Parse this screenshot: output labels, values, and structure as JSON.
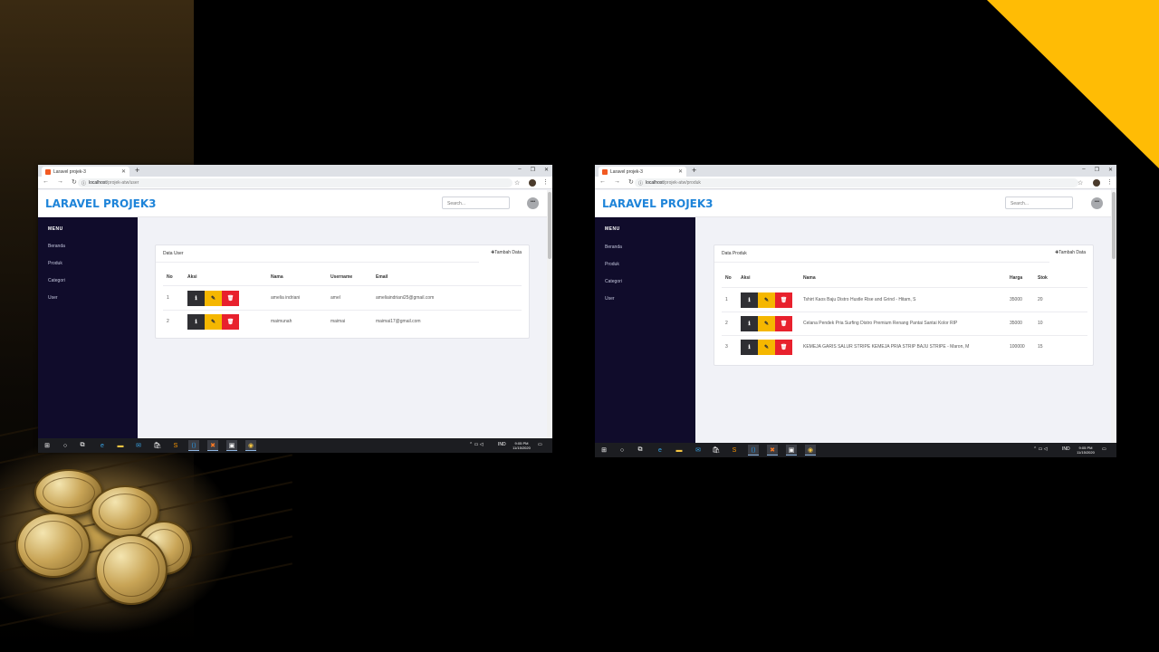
{
  "left_window": {
    "tab_title": "Laravel projek-3",
    "url_host": "localhost",
    "url_path": "/projek-atw/user",
    "app_title": "LARAVEL PROJEK3",
    "search_placeholder": "Search...",
    "avatar_text": "•••",
    "sidebar_menu_title": "MENU",
    "sidebar_items": [
      "Beranda",
      "Produk",
      "Categori",
      "User"
    ],
    "card_title": "Data User",
    "add_button": "✚Tambah Data",
    "table_headers": [
      "No",
      "Aksi",
      "Nama",
      "Username",
      "Email"
    ],
    "rows": [
      {
        "no": "1",
        "nama": "amelia indriani",
        "username": "amel",
        "email": "ameliaindriani25@gmail.com"
      },
      {
        "no": "2",
        "nama": "maimunah",
        "username": "maimai",
        "email": "maimai17@gmail.com"
      }
    ],
    "taskbar_lang": "IND",
    "taskbar_time": "9:05 PM",
    "taskbar_date": "11/15/2020"
  },
  "right_window": {
    "tab_title": "Laravel projek-3",
    "url_host": "localhost",
    "url_path": "/projek-atw/produk",
    "app_title": "LARAVEL PROJEK3",
    "search_placeholder": "Search...",
    "avatar_text": "•••",
    "sidebar_menu_title": "MENU",
    "sidebar_items": [
      "Beranda",
      "Produk",
      "Categori",
      "User"
    ],
    "card_title": "Data Produk",
    "add_button": "✚Tambah Data",
    "table_headers": [
      "No",
      "Aksi",
      "Nama",
      "Harga",
      "Stok"
    ],
    "rows": [
      {
        "no": "1",
        "nama": "Tshirt Kaos Baju Distro Hustle Rise and Grind - Hitam, S",
        "harga": "35000",
        "stok": "20"
      },
      {
        "no": "2",
        "nama": "Celana Pendek Pria Surfing Distro Premium Renang Pantai Santai Kolor RIP",
        "harga": "35000",
        "stok": "10"
      },
      {
        "no": "3",
        "nama": "KEMEJA GARIS SALUR STRIPE KEMEJA PRIA STRIP BAJU STRIPE - Maron, M",
        "harga": "100000",
        "stok": "15"
      }
    ],
    "taskbar_lang": "IND",
    "taskbar_time": "9:05 PM",
    "taskbar_date": "11/15/2020"
  },
  "icons": {
    "detail": "info-icon",
    "edit": "edit-icon",
    "delete": "trash-icon"
  },
  "colors": {
    "brand": "#1e84d9",
    "sidebar": "#100c2b",
    "detail_button": "#2f2f33",
    "edit_button": "#f5b700",
    "delete_button": "#e8212d",
    "slide_accent": "#ffbc05"
  }
}
